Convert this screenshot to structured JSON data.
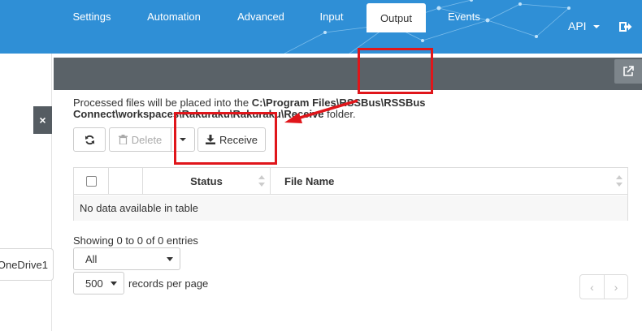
{
  "header": {
    "api_menu_label": "API",
    "brand_color": "#2f8fd6"
  },
  "left_pane": {
    "close_label": "×",
    "item_label": "OneDrive1"
  },
  "tabs": [
    {
      "label": "Settings",
      "active": false
    },
    {
      "label": "Automation",
      "active": false
    },
    {
      "label": "Advanced",
      "active": false
    },
    {
      "label": "Input",
      "active": false
    },
    {
      "label": "Output",
      "active": true
    },
    {
      "label": "Events",
      "active": false
    }
  ],
  "output": {
    "description_prefix": "Processed files will be placed into the ",
    "description_path": "C:\\Program Files\\RSSBus\\RSSBus Connect\\workspaces\\Rakuraku\\Rakuraku\\Receive",
    "description_suffix": " folder."
  },
  "toolbar": {
    "refresh_icon": "refresh-icon",
    "delete_label": "Delete",
    "receive_label": "Receive"
  },
  "table": {
    "columns": [
      "",
      "",
      "Status",
      "File Name"
    ],
    "empty_message": "No data available in table"
  },
  "footer": {
    "info": "Showing 0 to 0 of 0 entries",
    "filter_value": "All",
    "page_size_value": "500",
    "page_size_label": "records per page",
    "prev_label": "‹",
    "next_label": "›"
  },
  "annotation_color": "#e0161b"
}
